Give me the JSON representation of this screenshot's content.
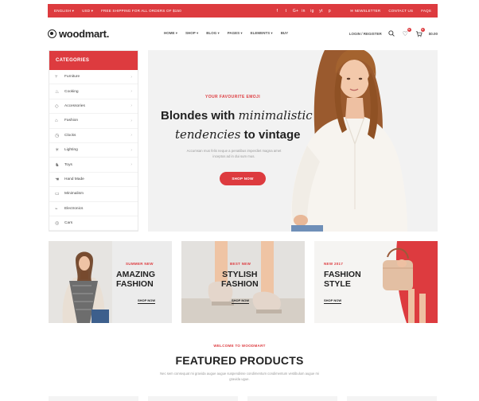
{
  "topbar": {
    "language": "ENGLISH",
    "currency": "USD",
    "promo": "FREE SHIPPING FOR ALL ORDERS OF $150",
    "socials": [
      "f",
      "t",
      "G+",
      "in",
      "ig",
      "yt",
      "p"
    ],
    "newsletter": "NEWSLETTER",
    "contact": "CONTACT US",
    "faqs": "FAQS"
  },
  "header": {
    "logo": "woodmart.",
    "nav": [
      "HOME",
      "SHOP",
      "BLOG",
      "PAGES",
      "ELEMENTS",
      "BUY"
    ],
    "login": "LOGIN / REGISTER",
    "cart_total": "$0.00",
    "wishlist_count": "0",
    "cart_count": "0"
  },
  "sidebar": {
    "title": "CATEGORIES",
    "items": [
      {
        "label": "Furniture",
        "icon": "chair-icon",
        "has_children": true
      },
      {
        "label": "Cooking",
        "icon": "pot-icon",
        "has_children": true
      },
      {
        "label": "Accessories",
        "icon": "gem-icon",
        "has_children": true
      },
      {
        "label": "Fashion",
        "icon": "shirt-icon",
        "has_children": true
      },
      {
        "label": "Clocks",
        "icon": "clock-icon",
        "has_children": true
      },
      {
        "label": "Lighting",
        "icon": "bulb-icon",
        "has_children": true
      },
      {
        "label": "Toys",
        "icon": "toy-icon",
        "has_children": true
      },
      {
        "label": "Hand Made",
        "icon": "hand-icon",
        "has_children": false
      },
      {
        "label": "Minimalism",
        "icon": "minimal-icon",
        "has_children": false
      },
      {
        "label": "Electronics",
        "icon": "plug-icon",
        "has_children": false
      },
      {
        "label": "Cars",
        "icon": "car-icon",
        "has_children": false
      }
    ]
  },
  "hero": {
    "subtitle": "YOUR FAVOURITE EMOJI",
    "line1_plain": "Blondes with ",
    "line1_italic": "minimalistic",
    "line2_italic": "tendencies",
    "line2_plain": " to vintage",
    "description": "Accumsan mus felis neque a penatibus imperdiet magna amet inceptos ad in dui sum mus.",
    "button": "SHOP NOW"
  },
  "promos": [
    {
      "tag": "SUMMER NEW",
      "title_l1": "AMAZING",
      "title_l2": "FASHION",
      "link": "SHOP NOW"
    },
    {
      "tag": "BEST NEW",
      "title_l1": "STYLISH",
      "title_l2": "FASHION",
      "link": "SHOP NOW"
    },
    {
      "tag": "NEW 2017",
      "title_l1": "FASHION",
      "title_l2": "STYLE",
      "link": "SHOP NOW"
    }
  ],
  "featured": {
    "welcome": "WELCOME TO WOODMART",
    "title": "FEATURED PRODUCTS",
    "description": "Nec sem consequat mi gravida augue augue suspendisse condimentum condimentum vestibulum augue mi gravida ugue."
  },
  "colors": {
    "accent": "#dd3b3f",
    "dark": "#222222"
  }
}
